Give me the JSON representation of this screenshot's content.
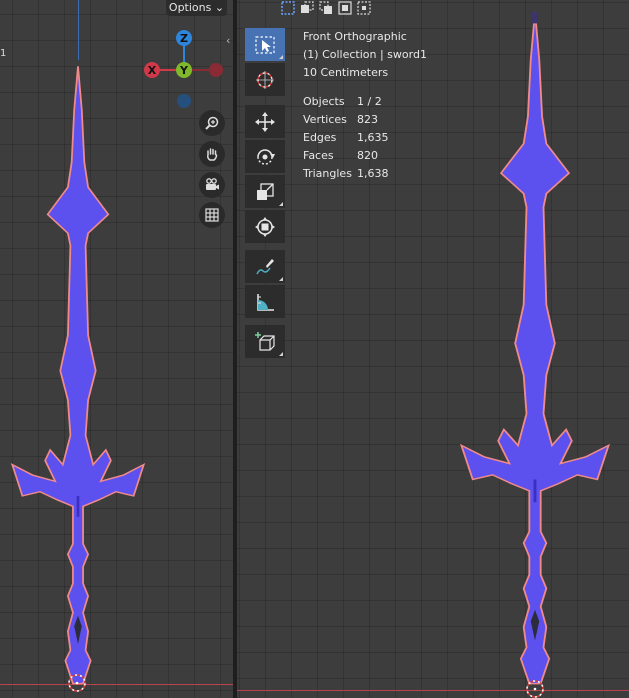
{
  "left_viewport": {
    "options_label": "Options",
    "edge_mark": "1"
  },
  "gizmo": {
    "z_label": "Z",
    "x_label": "X",
    "y_label": "Y"
  },
  "overlay": {
    "view_name": "Front Orthographic",
    "collection": "(1) Collection | sword1",
    "scale": "10 Centimeters",
    "stats": [
      {
        "label": "Objects",
        "value": "1 / 2"
      },
      {
        "label": "Vertices",
        "value": "823"
      },
      {
        "label": "Edges",
        "value": "1,635"
      },
      {
        "label": "Faces",
        "value": "820"
      },
      {
        "label": "Triangles",
        "value": "1,638"
      }
    ]
  },
  "colors": {
    "mesh_fill": "#5c50ef",
    "mesh_outline": "#f08a8a",
    "active_tool": "#4772b3",
    "axis_x": "#d1394b",
    "axis_y": "#7fb82a",
    "axis_z": "#2e86dc"
  },
  "toolbar": {
    "tools": [
      "select-box-icon",
      "cursor-icon",
      "move-icon",
      "rotate-icon",
      "scale-icon",
      "transform-icon",
      "annotate-icon",
      "measure-icon",
      "add-cube-icon"
    ],
    "active": "select-box-icon"
  },
  "navigation": [
    "zoom-icon",
    "hand-pan-icon",
    "camera-icon",
    "grid-icon"
  ]
}
